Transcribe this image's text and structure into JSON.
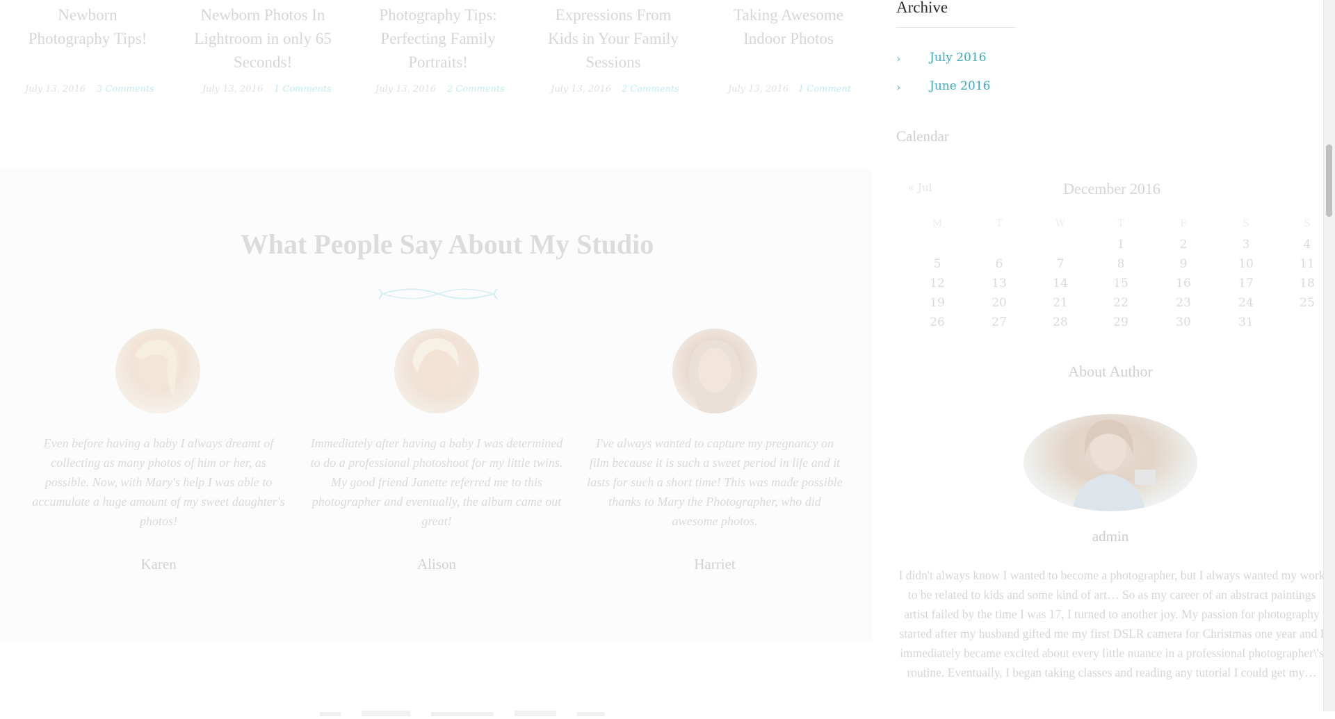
{
  "posts": [
    {
      "title": "Newborn Photography Tips!",
      "date": "July 13, 2016",
      "comments": "3 Comments"
    },
    {
      "title": "Newborn Photos In Lightroom in only 65 Seconds!",
      "date": "July 13, 2016",
      "comments": "1 Comments"
    },
    {
      "title": "Photography Tips: Perfecting Family Portraits!",
      "date": "July 13, 2016",
      "comments": "2 Comments"
    },
    {
      "title": "Expressions From Kids in Your Family Sessions",
      "date": "July 13, 2016",
      "comments": "2 Comments"
    },
    {
      "title": "Taking Awesome Indoor Photos",
      "date": "July 13, 2016",
      "comments": "1 Comment"
    }
  ],
  "testimonials": {
    "heading": "What People Say About My Studio",
    "items": [
      {
        "quote": "Even before having a baby I always dreamt of collecting as many photos of him or her, as possible. Now, with Mary's help I was able to accumulate a huge amount of my sweet daughter's photos!",
        "name": "Karen"
      },
      {
        "quote": "Immediately after having a baby I was determined to do a professional photoshoot for my little twins. My good friend Janette referred me to this photographer and eventually, the album came out great!",
        "name": "Alison"
      },
      {
        "quote": "I've always wanted to capture my pregnancy on film because it is such a sweet period in life and it lasts for such a short time! This was made possible thanks to Mary the Photographer, who did awesome photos.",
        "name": "Harriet"
      }
    ]
  },
  "sidebar": {
    "archive": {
      "title": "Archive",
      "items": [
        {
          "label": "July 2016"
        },
        {
          "label": "June 2016"
        }
      ]
    },
    "calendar": {
      "title": "Calendar",
      "prev": "« Jul",
      "caption": "December 2016",
      "weekdays": [
        "M",
        "T",
        "W",
        "T",
        "F",
        "S",
        "S"
      ],
      "weeks": [
        [
          "",
          "",
          "",
          "1",
          "2",
          "3",
          "4"
        ],
        [
          "5",
          "6",
          "7",
          "8",
          "9",
          "10",
          "11"
        ],
        [
          "12",
          "13",
          "14",
          "15",
          "16",
          "17",
          "18"
        ],
        [
          "19",
          "20",
          "21",
          "22",
          "23",
          "24",
          "25"
        ],
        [
          "26",
          "27",
          "28",
          "29",
          "30",
          "31",
          ""
        ]
      ]
    },
    "about": {
      "title": "About Author",
      "name": "admin",
      "bio": "I didn't always know I wanted to become a photographer, but I always wanted my work to be related to kids and some kind of art… So as my career of an abstract paintings artist failed by the time I was 17, I turned to another joy. My passion for photography started after my husband gifted me my first DSLR camera for Christmas one year and I immediately became excited about every little nuance in a professional photographer\\'s routine. Eventually, I began taking classes and reading any tutorial I could get my…"
    }
  },
  "colors": {
    "accent": "#3aa9bd",
    "faded_text": "#d6d6d6",
    "section_bg": "#fcfcfc"
  }
}
